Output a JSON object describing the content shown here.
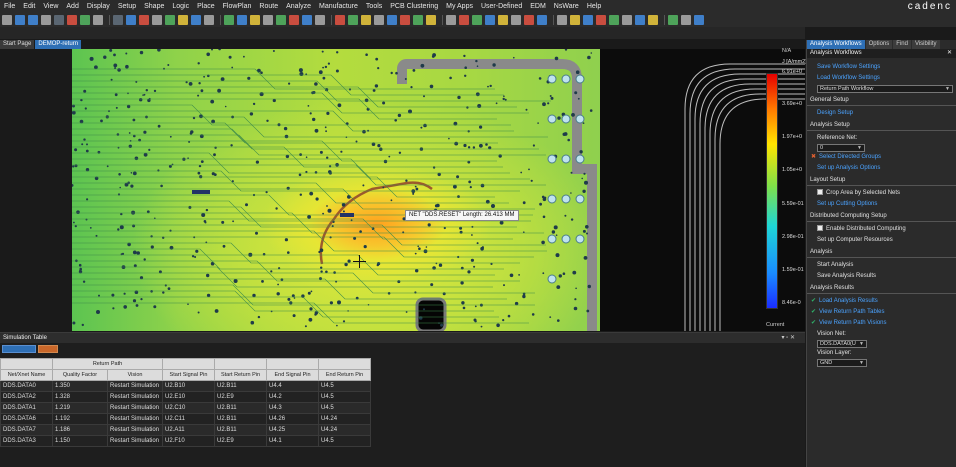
{
  "menu": [
    "File",
    "Edit",
    "View",
    "Add",
    "Display",
    "Setup",
    "Shape",
    "Logic",
    "Place",
    "FlowPlan",
    "Route",
    "Analyze",
    "Manufacture",
    "Tools",
    "PCB Clustering",
    "My Apps",
    "User-Defined",
    "EDM",
    "NsWare",
    "Help"
  ],
  "brand": "cadenc",
  "tabs": [
    "Start Page",
    "DEMOP-return"
  ],
  "tooltip": "NET \"DDS.RESET\"  Length: 26.413 MM",
  "legend": {
    "na": "N/A",
    "unit": "J [A/mm2]",
    "ticks": [
      "6.91e+0",
      "3.69e+0",
      "1.97e+0",
      "1.05e+0",
      "5.59e-01",
      "2.98e-01",
      "1.59e-01",
      "8.46e-0"
    ],
    "current": "Current"
  },
  "table": {
    "title": "Simulation Table",
    "group_header": "Return Path",
    "columns": [
      "Net/Xnet Name",
      "Quality Factor",
      "Vision",
      "Start Signal Pin",
      "Start Return Pin",
      "End Signal Pin",
      "End Return Pin"
    ],
    "rows": [
      [
        "DDS.DATA0",
        "1.350",
        "Restart Simulation",
        "U2.B10",
        "U2.B11",
        "U4.4",
        "U4.5"
      ],
      [
        "DDS.DATA2",
        "1.328",
        "Restart Simulation",
        "U2.E10",
        "U2.E9",
        "U4.2",
        "U4.5"
      ],
      [
        "DDS.DATA1",
        "1.219",
        "Restart Simulation",
        "U2.C10",
        "U2.B11",
        "U4.3",
        "U4.5"
      ],
      [
        "DDS.DATA6",
        "1.192",
        "Restart Simulation",
        "U2.C11",
        "U2.B11",
        "U4.26",
        "U4.24"
      ],
      [
        "DDS.DATA7",
        "1.186",
        "Restart Simulation",
        "U2.A11",
        "U2.B11",
        "U4.25",
        "U4.24"
      ],
      [
        "DDS.DATA3",
        "1.150",
        "Restart Simulation",
        "U2.F10",
        "U2.E9",
        "U4.1",
        "U4.5"
      ]
    ]
  },
  "panel": {
    "tabs": [
      "Analysis Workflows",
      "Options",
      "Find",
      "Visibility"
    ],
    "title": "Analysis Workflows",
    "save_workflow": "Save Workflow Settings",
    "load_workflow": "Load Workflow Settings",
    "workflow_value": "Return Path Workflow",
    "general_setup": "General Setup",
    "design_setup": "Design Setup",
    "analysis_setup": "Analysis Setup",
    "reference_net_label": "Reference Net:",
    "reference_net_value": "0",
    "select_directed_groups": "Select Directed Groups",
    "setup_analysis_options": "Set up Analysis Options",
    "layout_setup": "Layout Setup",
    "crop_area": "Crop Area by Selected Nets",
    "setup_cutting": "Set up Cutting Options",
    "distributed_setup": "Distributed Computing Setup",
    "enable_distributed": "Enable Distributed Computing",
    "setup_computer": "Set up Computer Resources",
    "analysis": "Analysis",
    "start_analysis": "Start Analysis",
    "save_analysis": "Save Analysis Results",
    "analysis_results": "Analysis Results",
    "load_analysis": "Load Analysis Results",
    "view_tables": "View Return Path Tables",
    "view_visions": "View Return Path Visions",
    "vision_net_label": "Vision Net:",
    "vision_net_value": "DDS.DATA0(U",
    "vision_layer_label": "Vision Layer:",
    "vision_layer_value": "GND"
  }
}
